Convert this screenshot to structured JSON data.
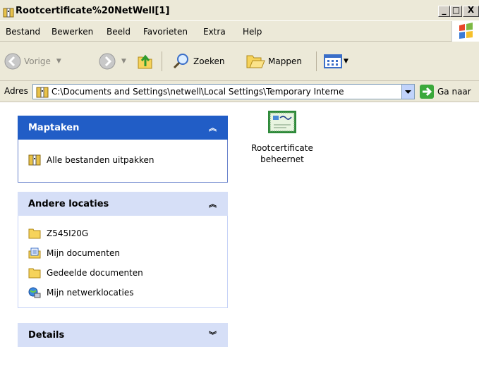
{
  "window": {
    "title": "Rootcertificate%20NetWell[1]",
    "min": "_",
    "max": "□",
    "close": "X"
  },
  "menu": [
    "Bestand",
    "Bewerken",
    "Beeld",
    "Favorieten",
    "Extra",
    "Help"
  ],
  "toolbar": {
    "back": "Vorige",
    "search": "Zoeken",
    "folders": "Mappen"
  },
  "address": {
    "label": "Adres",
    "path": "C:\\Documents and Settings\\netwell\\Local Settings\\Temporary Interne",
    "go": "Ga naar"
  },
  "tasks": {
    "title": "Maptaken",
    "items": [
      "Alle bestanden uitpakken"
    ]
  },
  "places": {
    "title": "Andere locaties",
    "items": [
      "Z545I20G",
      "Mijn documenten",
      "Gedeelde documenten",
      "Mijn netwerklocaties"
    ]
  },
  "details": {
    "title": "Details"
  },
  "file": {
    "line1": "Rootcertificate",
    "line2": "beheernet"
  }
}
